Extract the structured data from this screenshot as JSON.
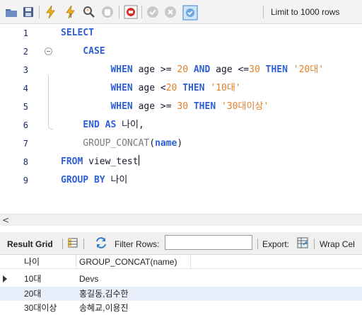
{
  "toolbar": {
    "limit_label": "Limit to 1000 rows"
  },
  "editor": {
    "lines": [
      {
        "num": "1",
        "tokens": [
          {
            "t": "SELECT",
            "c": "kw"
          }
        ]
      },
      {
        "num": "2",
        "tokens": [
          {
            "t": "    CASE",
            "c": "kw"
          }
        ]
      },
      {
        "num": "3",
        "tokens": [
          {
            "t": "         WHEN ",
            "c": "kw"
          },
          {
            "t": "age ",
            "c": "idf"
          },
          {
            "t": ">= ",
            "c": "idf"
          },
          {
            "t": "20",
            "c": "num"
          },
          {
            "t": " AND ",
            "c": "kw"
          },
          {
            "t": "age ",
            "c": "idf"
          },
          {
            "t": "<=",
            "c": "idf"
          },
          {
            "t": "30",
            "c": "num"
          },
          {
            "t": " THEN ",
            "c": "kw"
          },
          {
            "t": "'20대'",
            "c": "str"
          }
        ]
      },
      {
        "num": "4",
        "tokens": [
          {
            "t": "         WHEN ",
            "c": "kw"
          },
          {
            "t": "age ",
            "c": "idf"
          },
          {
            "t": "<",
            "c": "idf"
          },
          {
            "t": "20",
            "c": "num"
          },
          {
            "t": " THEN ",
            "c": "kw"
          },
          {
            "t": "'10대'",
            "c": "str"
          }
        ]
      },
      {
        "num": "5",
        "tokens": [
          {
            "t": "         WHEN ",
            "c": "kw"
          },
          {
            "t": "age ",
            "c": "idf"
          },
          {
            "t": ">= ",
            "c": "idf"
          },
          {
            "t": "30",
            "c": "num"
          },
          {
            "t": " THEN ",
            "c": "kw"
          },
          {
            "t": "'30대이상'",
            "c": "str"
          }
        ]
      },
      {
        "num": "6",
        "tokens": [
          {
            "t": "    END AS ",
            "c": "kw"
          },
          {
            "t": "나이,",
            "c": "idf"
          }
        ]
      },
      {
        "num": "7",
        "tokens": [
          {
            "t": "    GROUP_CONCAT",
            "c": "fn"
          },
          {
            "t": "(",
            "c": "idf"
          },
          {
            "t": "name",
            "c": "kw"
          },
          {
            "t": ")",
            "c": "idf"
          }
        ]
      },
      {
        "num": "8",
        "tokens": [
          {
            "t": "FROM ",
            "c": "kw"
          },
          {
            "t": "view_test",
            "c": "idf"
          }
        ]
      },
      {
        "num": "9",
        "tokens": [
          {
            "t": "GROUP BY ",
            "c": "kw"
          },
          {
            "t": "나이",
            "c": "idf"
          }
        ]
      }
    ]
  },
  "scrollbar": {
    "left_arrow": "<"
  },
  "result_bar": {
    "result_grid": "Result Grid",
    "filter_rows": "Filter Rows:",
    "export": "Export:",
    "wrap": "Wrap Cel"
  },
  "grid": {
    "columns": [
      "나이",
      "GROUP_CONCAT(name)"
    ],
    "rows": [
      [
        "10대",
        "Devs"
      ],
      [
        "20대",
        "홍길동,김수한"
      ],
      [
        "30대이상",
        "송혜교,이용진"
      ]
    ]
  }
}
